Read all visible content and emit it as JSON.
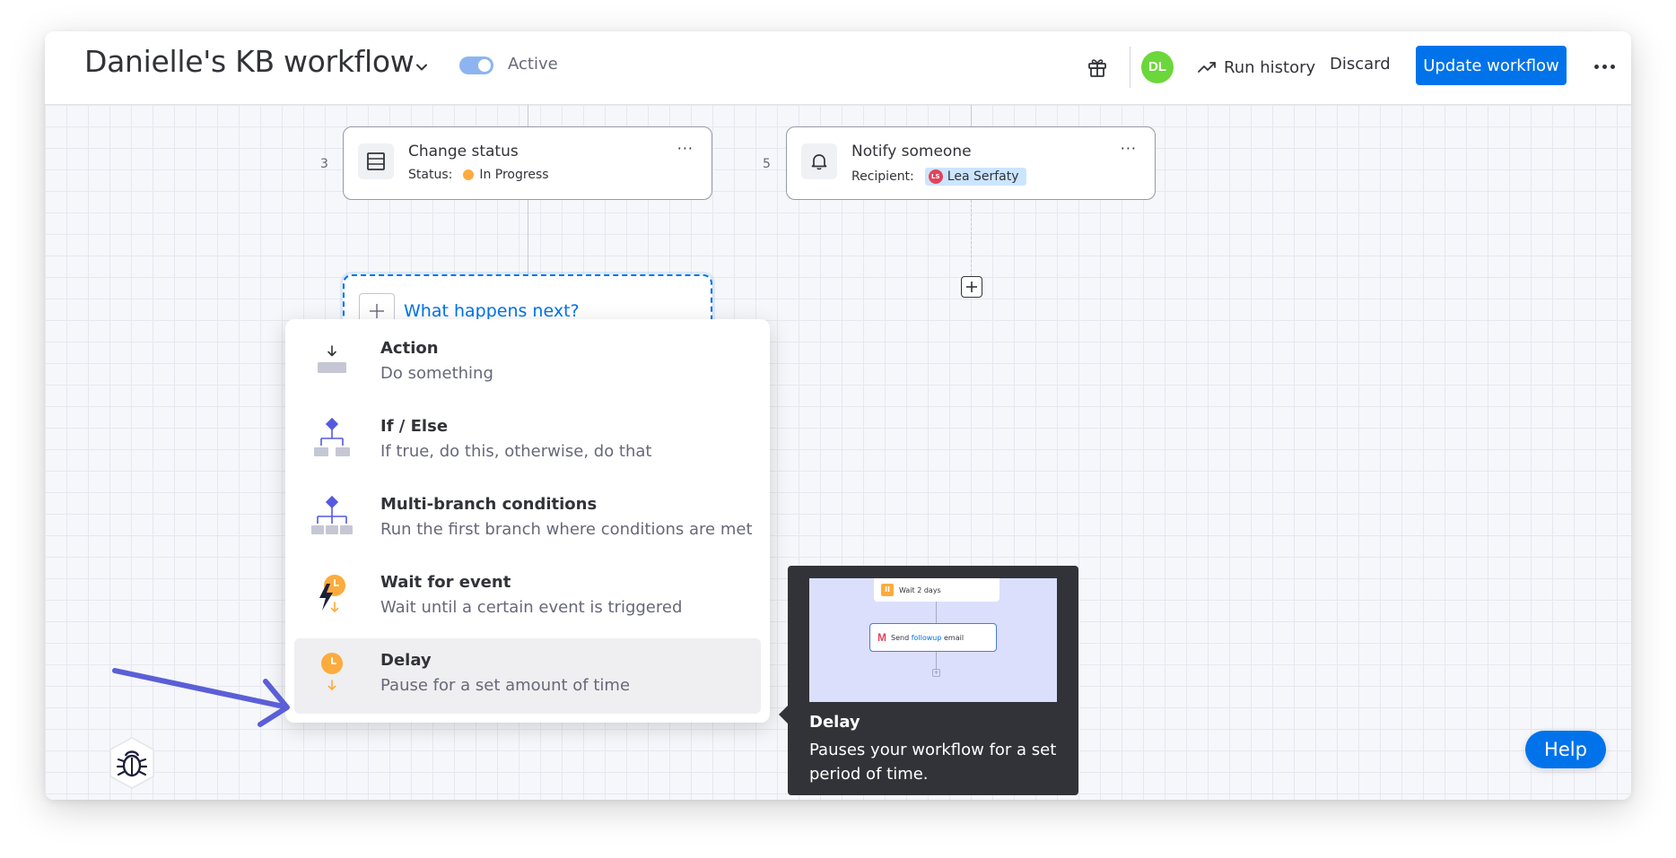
{
  "header": {
    "title": "Danielle's KB workflow",
    "toggle_label": "Active",
    "toggle_on": true,
    "avatar_initials": "DL",
    "run_history_label": "Run history",
    "discard_label": "Discard",
    "update_label": "Update workflow",
    "accent_color": "#0073ea"
  },
  "nodes": [
    {
      "step": "3",
      "title": "Change status",
      "sub_label": "Status:",
      "sub_value": "In Progress",
      "icon": "table-icon",
      "status_color": "#fdab3d"
    },
    {
      "step": "5",
      "title": "Notify someone",
      "sub_label": "Recipient:",
      "sub_value": "Lea Serfaty",
      "chip_initials": "LS",
      "icon": "bell-icon"
    }
  ],
  "next_step": {
    "label": "What happens next?"
  },
  "menu": {
    "items": [
      {
        "title": "Action",
        "desc": "Do something",
        "icon": "action-icon"
      },
      {
        "title": "If / Else",
        "desc": "If true, do this, otherwise, do that",
        "icon": "if-else-icon"
      },
      {
        "title": "Multi-branch conditions",
        "desc": "Run the first branch where conditions are met",
        "icon": "multi-branch-icon"
      },
      {
        "title": "Wait for event",
        "desc": "Wait until a certain event is triggered",
        "icon": "wait-event-icon"
      },
      {
        "title": "Delay",
        "desc": "Pause for a set amount of time",
        "icon": "delay-icon",
        "hovered": true
      }
    ]
  },
  "tooltip": {
    "title": "Delay",
    "desc": "Pauses your workflow for a set period of time.",
    "preview": {
      "card1_text": "Wait 2 days",
      "card2_prefix": "Send ",
      "card2_highlight": "followup",
      "card2_suffix": " email",
      "pause_glyph": "II",
      "gmail_glyph": "M",
      "plus_glyph": "+"
    }
  },
  "help_label": "Help",
  "glyphs": {
    "node_more": "···"
  }
}
